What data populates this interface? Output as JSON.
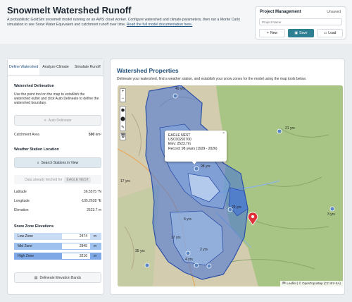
{
  "header": {
    "title": "Snowmelt Watershed Runoff",
    "description": "A probabilistic GoldSim snowmelt model running on an AWS cloud worker. Configure watershed and climate parameters, then run a Monte Carlo simulation to see Snow Water Equivalent and catchment runoff over time.",
    "doc_link": "Read the full model documentation here."
  },
  "project": {
    "title": "Project Management",
    "status": "Unsaved",
    "name_placeholder": "Project Name",
    "new_label": "New",
    "save_label": "Save",
    "load_label": "Load"
  },
  "tabs": [
    "Define Watershed",
    "Analyze Climate",
    "Simulate Runoff"
  ],
  "delineation": {
    "heading": "Watershed Delineation",
    "instructions": "Use the point tool on the map to establish the watershed outlet and click Auto Delineate to define the watershed boundary.",
    "auto_button": "Auto Delineate",
    "area_label": "Catchment Area",
    "area_value": "590",
    "area_unit": "km²"
  },
  "station": {
    "heading": "Weather Station Location",
    "search_button": "Search Stations in View",
    "fetched_text": "Data already fetched for",
    "fetched_name": "EAGLE NEST",
    "lat_label": "Latitude",
    "lat_value": "36.5575 °N",
    "lon_label": "Longitude",
    "lon_value": "-105.2628 °E",
    "elev_label": "Elevation",
    "elev_value": "2523.7 m"
  },
  "zones": {
    "heading": "Snow Zone Elevations",
    "items": [
      {
        "label": "Low Zone",
        "value": "2474",
        "unit": "m",
        "color": "#c9dcf6"
      },
      {
        "label": "Mid Zone",
        "value": "2845",
        "unit": "m",
        "color": "#9fc1ee"
      },
      {
        "label": "High Zone",
        "value": "3216",
        "unit": "m",
        "color": "#7ea8e6"
      }
    ],
    "bands_button": "Delineate Elevation Bands"
  },
  "main": {
    "title": "Watershed Properties",
    "description": "Delineate your watershed, find a weather station, and establish your snow zones for the model using the map tools below."
  },
  "map": {
    "controls": [
      "+",
      "−",
      "⬢",
      "⬤",
      "✎",
      "🗑"
    ],
    "popup": {
      "name": "EAGLE NEST",
      "id": "USC00292700",
      "elev": "Elev: 2523.7m",
      "record": "Record: 98 years (1929 - 2026)",
      "close": "×"
    },
    "labels": [
      "49 yrs",
      "17 yrs",
      "21 yrs",
      "98 yrs",
      "29 yrs",
      "6 yrs",
      "17 yrs",
      "35 yrs",
      "2 yrs",
      "4 yrs",
      "3 yrs"
    ],
    "attribution": "🏁 Leaflet | © OpenTopoMap (CC-BY-SA)"
  },
  "colors": {
    "accent": "#1f4e79",
    "save": "#2f7f93",
    "watershed": "#3f6fd8",
    "marker": "#e0313b"
  }
}
